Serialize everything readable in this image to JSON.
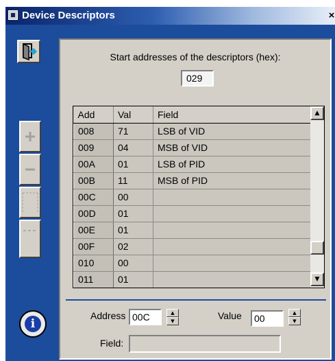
{
  "window": {
    "title": "Device Descriptors",
    "close_symbol": "×"
  },
  "start": {
    "label": "Start addresses of the descriptors (hex):",
    "value": "029"
  },
  "grid": {
    "columns": [
      "Add",
      "Val",
      "Field"
    ],
    "rows": [
      {
        "add": "008",
        "val": "71",
        "field": "LSB of VID"
      },
      {
        "add": "009",
        "val": "04",
        "field": "MSB of VID"
      },
      {
        "add": "00A",
        "val": "01",
        "field": "LSB of PID"
      },
      {
        "add": "00B",
        "val": "11",
        "field": "MSB of PID"
      },
      {
        "add": "00C",
        "val": "00",
        "field": ""
      },
      {
        "add": "00D",
        "val": "01",
        "field": ""
      },
      {
        "add": "00E",
        "val": "01",
        "field": ""
      },
      {
        "add": "00F",
        "val": "02",
        "field": ""
      },
      {
        "add": "010",
        "val": "00",
        "field": ""
      },
      {
        "add": "011",
        "val": "01",
        "field": ""
      }
    ]
  },
  "editor": {
    "address_label": "Address",
    "address_value": "00C",
    "value_label": "Value",
    "value_value": "00",
    "field_label": "Field:",
    "field_value": ""
  },
  "icons": {
    "exit": "exit-door-icon",
    "add": "add-icon",
    "remove": "remove-icon",
    "insert": "insert-row-icon",
    "delete": "delete-row-icon",
    "info": "info-icon"
  },
  "colors": {
    "background": "#1c4c9c",
    "panel": "#d4d0c8",
    "title_gradient_start": "#0a246a"
  }
}
